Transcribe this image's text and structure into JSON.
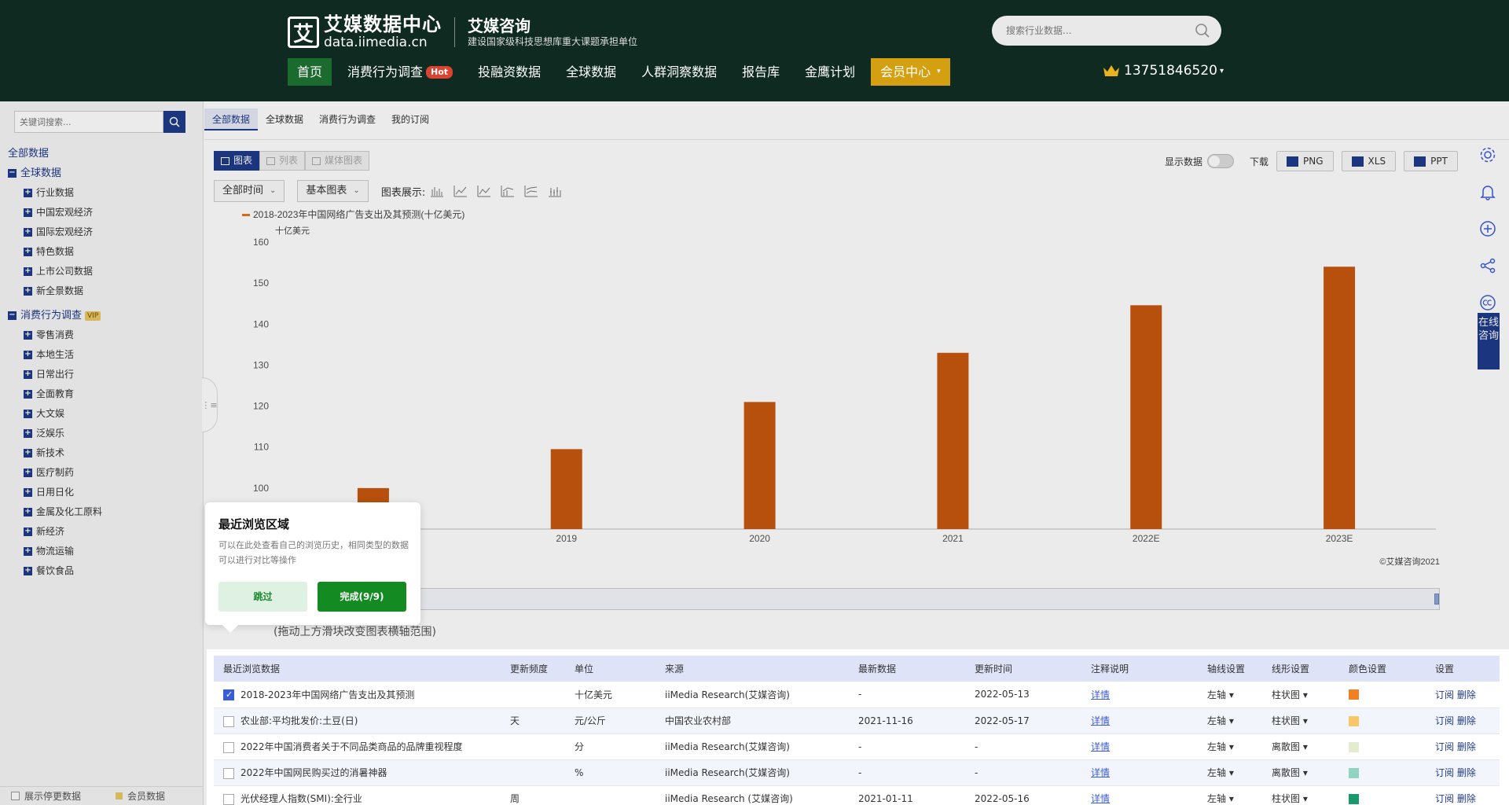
{
  "header": {
    "logo_mark": "艾",
    "logo_title": "艾媒数据中心",
    "logo_url": "data.iimedia.cn",
    "brand_title": "艾媒咨询",
    "brand_sub": "建设国家级科技思想库重大课题承担单位",
    "search_placeholder": "搜索行业数据...",
    "nav": [
      "首页",
      "消费行为调查",
      "投融资数据",
      "全球数据",
      "人群洞察数据",
      "报告库",
      "金鹰计划",
      "会员中心"
    ],
    "hot_badge": "Hot",
    "user_phone": "13751846520"
  },
  "sidebar": {
    "search_placeholder": "关键词搜索...",
    "root": "全部数据",
    "groups": [
      {
        "label": "全球数据",
        "items": [
          "行业数据",
          "中国宏观经济",
          "国际宏观经济",
          "特色数据",
          "上市公司数据",
          "新全景数据"
        ]
      },
      {
        "label": "消费行为调查",
        "badge": "VIP",
        "items": [
          "零售消费",
          "本地生活",
          "日常出行",
          "全面教育",
          "大文娱",
          "泛娱乐",
          "新技术",
          "医疗制药",
          "日用日化",
          "金属及化工原料",
          "新经济",
          "物流运输",
          "餐饮食品"
        ]
      }
    ],
    "bottom_left": "展示停更数据",
    "bottom_right": "会员数据"
  },
  "tabs": [
    "全部数据",
    "全球数据",
    "消费行为调查",
    "我的订阅"
  ],
  "toolbar": {
    "views": [
      "图表",
      "列表",
      "媒体图表"
    ],
    "show_values": "显示数据",
    "download": "下载",
    "formats": [
      "PNG",
      "XLS",
      "PPT"
    ],
    "time_select": "全部时间",
    "chart_select": "基本图表",
    "chart_display": "图表展示:"
  },
  "chart_data": {
    "type": "bar",
    "legend": "2018-2023年中国网络广告支出及其预测(十亿美元)",
    "ylabel": "十亿美元",
    "categories": [
      "2018",
      "2019",
      "2020",
      "2021",
      "2022E",
      "2023E"
    ],
    "values": [
      100,
      109.5,
      121,
      133,
      144.6,
      154
    ],
    "ylim": [
      90,
      160
    ],
    "yticks": [
      100,
      110,
      120,
      130,
      140,
      150,
      160
    ],
    "bar_color": "#c8570f",
    "copyright": "©艾媒咨询2021"
  },
  "drag_tip": "(拖动上方滑块改变图表横轴范围)",
  "right_rail": {
    "consult": "在线咨询"
  },
  "popup": {
    "title": "最近浏览区域",
    "desc": "可以在此处查看自己的浏览历史，相同类型的数据可以进行对比等操作",
    "skip": "跳过",
    "done": "完成(9/9)"
  },
  "table": {
    "headers": [
      "最近浏览数据",
      "更新频度",
      "单位",
      "来源",
      "最新数据",
      "更新时间",
      "注释说明",
      "轴线设置",
      "线形设置",
      "颜色设置",
      "设置"
    ],
    "rows": [
      {
        "name": "2018-2023年中国网络广告支出及其预测",
        "freq": "",
        "unit": "十亿美元",
        "source": "iiMedia Research(艾媒咨询)",
        "latest": "-",
        "updated": "2022-05-13",
        "note": "详情",
        "axis": "左轴 ▾",
        "shape": "柱状图 ▾",
        "color": "#f08020",
        "checked": true
      },
      {
        "name": "农业部:平均批发价:土豆(日)",
        "freq": "天",
        "unit": "元/公斤",
        "source": "中国农业农村部",
        "latest": "2021-11-16",
        "updated": "2022-05-17",
        "note": "详情",
        "axis": "左轴 ▾",
        "shape": "柱状图 ▾",
        "color": "#f7c86a",
        "checked": false
      },
      {
        "name": "2022年中国消费者关于不同品类商品的品牌重视程度",
        "freq": "",
        "unit": "分",
        "source": "iiMedia Research(艾媒咨询)",
        "latest": "-",
        "updated": "-",
        "note": "详情",
        "axis": "左轴 ▾",
        "shape": "离散图 ▾",
        "color": "#e3eccf",
        "checked": false
      },
      {
        "name": "2022年中国网民购买过的消暑神器",
        "freq": "",
        "unit": "%",
        "source": "iiMedia Research(艾媒咨询)",
        "latest": "-",
        "updated": "-",
        "note": "详情",
        "axis": "左轴 ▾",
        "shape": "离散图 ▾",
        "color": "#8fd3c0",
        "checked": false
      },
      {
        "name": "光伏经理人指数(SMI):全行业",
        "freq": "周",
        "unit": "",
        "source": "iiMedia Research (艾媒咨询)",
        "latest": "2021-01-11",
        "updated": "2022-05-16",
        "note": "详情",
        "axis": "左轴 ▾",
        "shape": "柱状图 ▾",
        "color": "#1a9a6c",
        "checked": false
      }
    ],
    "actions": "订阅 删除"
  }
}
